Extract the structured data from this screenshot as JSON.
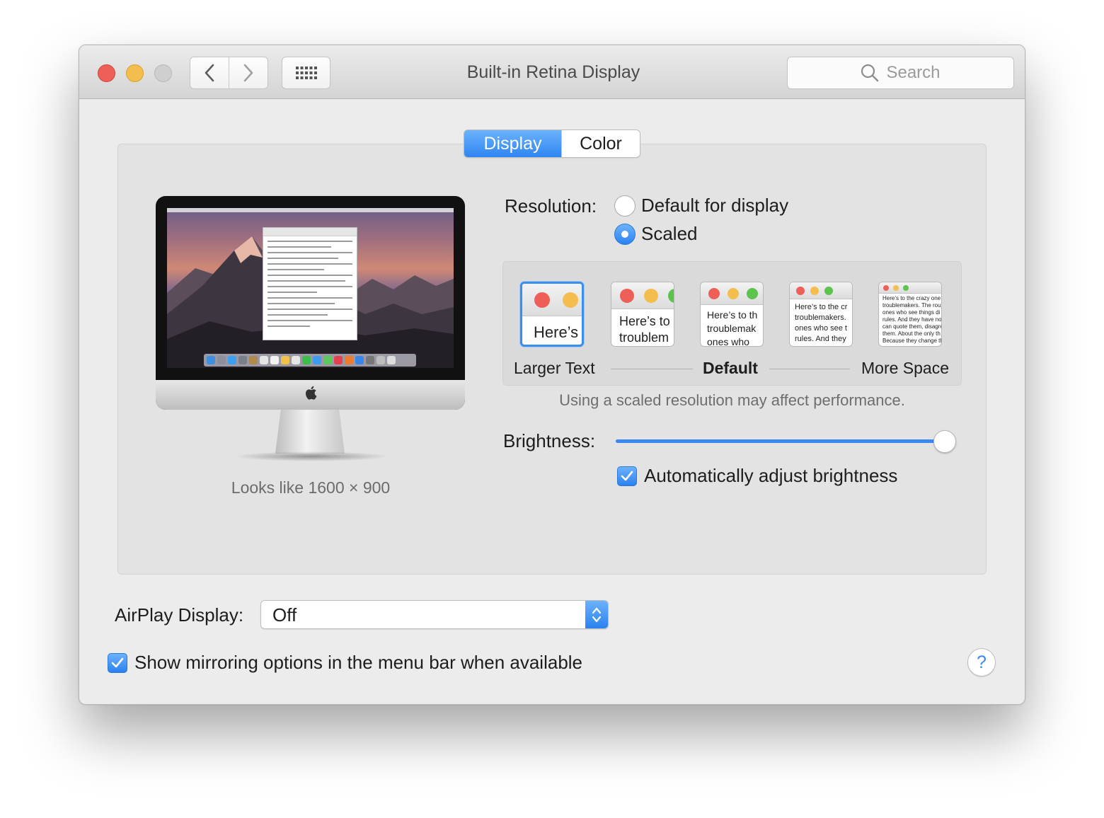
{
  "window": {
    "title": "Built-in Retina Display"
  },
  "toolbar": {
    "search_placeholder": "Search"
  },
  "tabs": [
    {
      "label": "Display",
      "selected": true
    },
    {
      "label": "Color",
      "selected": false
    }
  ],
  "preview": {
    "looks_like": "Looks like 1600 × 900"
  },
  "resolution": {
    "label": "Resolution:",
    "options": [
      {
        "label": "Default for display",
        "selected": false
      },
      {
        "label": "Scaled",
        "selected": true
      }
    ]
  },
  "scaled_options": {
    "thumbnails": [
      {
        "lines": [
          "Here’s"
        ],
        "selected": true
      },
      {
        "lines": [
          "Here’s to",
          "troublem"
        ],
        "selected": false
      },
      {
        "lines": [
          "Here’s to th",
          "troublemak",
          "ones who"
        ],
        "selected": false
      },
      {
        "lines": [
          "Here’s to the cr",
          "troublemakers.",
          "ones who see t",
          "rules. And they"
        ],
        "selected": false
      },
      {
        "lines": [
          "Here’s to the crazy one",
          "troublemakers. The rou",
          "ones who see things di",
          "rules. And they have no",
          "can quote them, disagre",
          "them. About the only th",
          "Because they change th"
        ],
        "selected": false
      }
    ],
    "labels": {
      "left": "Larger Text",
      "middle": "Default",
      "right": "More Space"
    },
    "note": "Using a scaled resolution may affect performance."
  },
  "brightness": {
    "label": "Brightness:",
    "level": 0.97
  },
  "auto_brightness": {
    "label": "Automatically adjust brightness",
    "checked": true
  },
  "airplay": {
    "label": "AirPlay Display:",
    "value": "Off"
  },
  "mirroring": {
    "label": "Show mirroring options in the menu bar when available",
    "checked": true
  },
  "help": {
    "label": "?"
  },
  "colors": {
    "accent": "#3a88ef",
    "close": "#ed5f57",
    "minimize": "#f4be4f",
    "maximize_disabled": "#cfcfcf"
  },
  "icons": [
    "back-chevron-icon",
    "forward-chevron-icon",
    "grid-icon",
    "search-icon",
    "apple-logo-icon",
    "checkmark-icon",
    "updown-arrows-icon"
  ]
}
